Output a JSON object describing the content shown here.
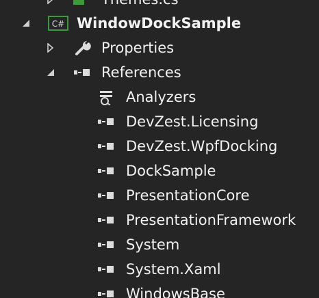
{
  "tree": {
    "top_partial": {
      "label": "Themes.cs"
    },
    "project": {
      "label": "WindowDockSample",
      "icon": "csharp-project-icon"
    },
    "properties": {
      "label": "Properties",
      "icon": "wrench-icon"
    },
    "references": {
      "label": "References",
      "icon": "reference-icon"
    },
    "reference_items": [
      {
        "label": "Analyzers",
        "icon": "analyzer-icon"
      },
      {
        "label": "DevZest.Licensing",
        "icon": "reference-icon"
      },
      {
        "label": "DevZest.WpfDocking",
        "icon": "reference-icon"
      },
      {
        "label": "DockSample",
        "icon": "reference-icon"
      },
      {
        "label": "PresentationCore",
        "icon": "reference-icon"
      },
      {
        "label": "PresentationFramework",
        "icon": "reference-icon"
      },
      {
        "label": "System",
        "icon": "reference-icon"
      },
      {
        "label": "System.Xaml",
        "icon": "reference-icon"
      },
      {
        "label": "WindowsBase",
        "icon": "reference-icon"
      }
    ]
  },
  "colors": {
    "background": "#252526",
    "text": "#f1f1f1",
    "csharp_box": "#3c9a3c",
    "icon": "#dcdcdc"
  }
}
